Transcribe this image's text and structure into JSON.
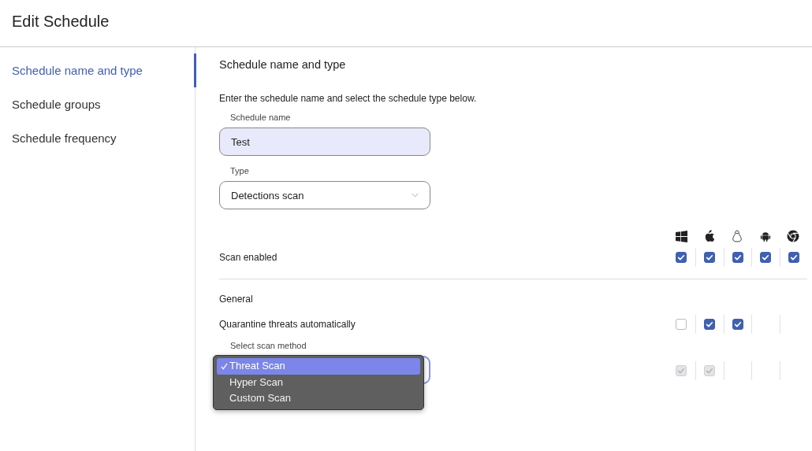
{
  "title": "Edit Schedule",
  "sidebar": {
    "items": [
      {
        "label": "Schedule name and type",
        "selected": true
      },
      {
        "label": "Schedule groups",
        "selected": false
      },
      {
        "label": "Schedule frequency",
        "selected": false
      }
    ]
  },
  "section_title": "Schedule name and type",
  "intro": "Enter the schedule name and select the schedule type below.",
  "name_field": {
    "label": "Schedule name",
    "value": "Test"
  },
  "type_field": {
    "label": "Type",
    "value": "Detections scan"
  },
  "platforms": [
    {
      "kind": "windows"
    },
    {
      "kind": "apple"
    },
    {
      "kind": "linux"
    },
    {
      "kind": "android"
    },
    {
      "kind": "chrome"
    }
  ],
  "rows": [
    {
      "label": "Scan enabled",
      "cells": [
        {
          "kind": "checkbox",
          "checked": true,
          "disabled": false
        },
        {
          "kind": "checkbox",
          "checked": true,
          "disabled": false
        },
        {
          "kind": "checkbox",
          "checked": true,
          "disabled": false
        },
        {
          "kind": "checkbox",
          "checked": true,
          "disabled": false
        },
        {
          "kind": "checkbox",
          "checked": true,
          "disabled": false
        }
      ]
    }
  ],
  "general": {
    "heading": "General",
    "rows": [
      {
        "label": "Quarantine threats automatically",
        "cells": [
          {
            "kind": "checkbox",
            "checked": false,
            "disabled": false
          },
          {
            "kind": "checkbox",
            "checked": true,
            "disabled": false
          },
          {
            "kind": "checkbox",
            "checked": true,
            "disabled": false
          },
          {
            "kind": "empty"
          },
          {
            "kind": "empty"
          }
        ]
      }
    ]
  },
  "scan_method": {
    "label": "Select scan method",
    "options": [
      {
        "label": "Threat Scan",
        "selected": true
      },
      {
        "label": "Hyper Scan",
        "selected": false
      },
      {
        "label": "Custom Scan",
        "selected": false
      }
    ],
    "cells": [
      {
        "kind": "checkbox",
        "checked": true,
        "disabled": true
      },
      {
        "kind": "checkbox",
        "checked": true,
        "disabled": true
      },
      {
        "kind": "empty"
      },
      {
        "kind": "empty"
      },
      {
        "kind": "empty"
      }
    ]
  }
}
